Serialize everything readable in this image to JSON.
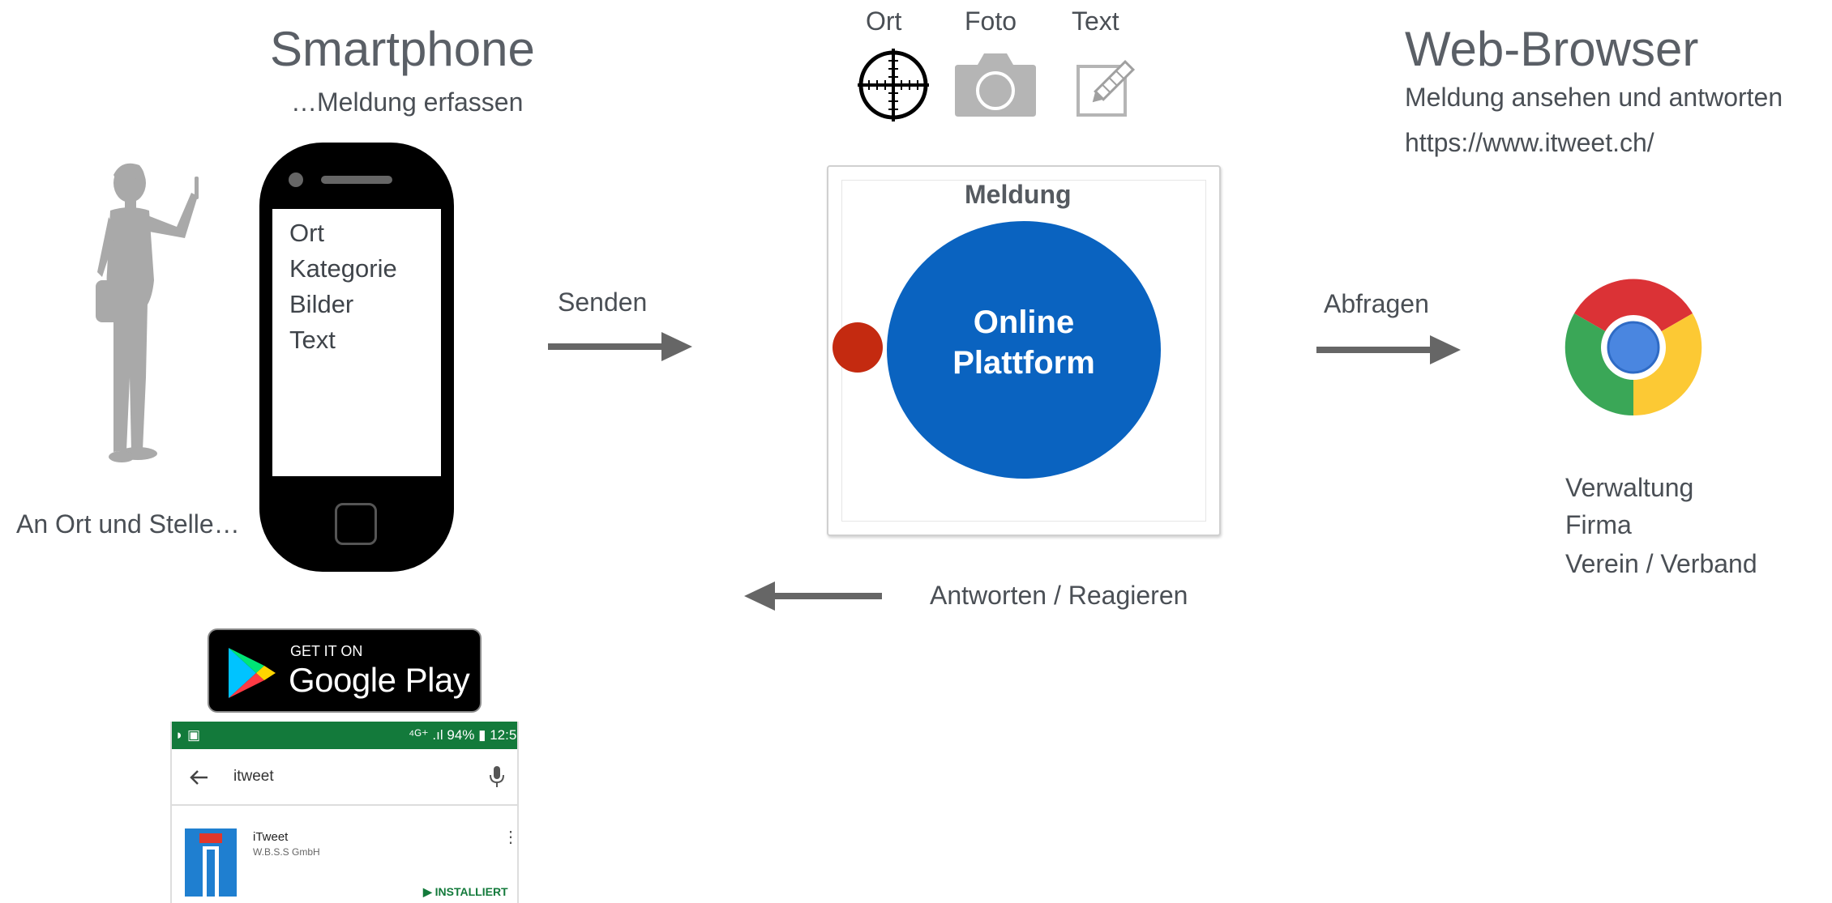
{
  "smartphone": {
    "title": "Smartphone",
    "subtitle": "…Meldung erfassen",
    "screen_lines": [
      "Ort",
      "Kategorie",
      "Bilder",
      "Text"
    ],
    "person_caption": "An Ort und Stelle…"
  },
  "arrows": {
    "send": "Senden",
    "query": "Abfragen",
    "respond": "Antworten / Reagieren"
  },
  "inputs": {
    "items": [
      "Ort",
      "Foto",
      "Text"
    ]
  },
  "platform": {
    "title": "Meldung",
    "circle_line1": "Online",
    "circle_line2": "Plattform"
  },
  "browser": {
    "title": "Web-Browser",
    "subtitle": "Meldung ansehen und antworten",
    "url": "https://www.itweet.ch/",
    "users": [
      "Verwaltung",
      "Firma",
      "Verein / Verband"
    ]
  },
  "google_play": {
    "small": "GET IT ON",
    "big": "Google Play"
  },
  "play_store": {
    "status": "⁴ᴳ⁺ .ıl 94% ▮ 12:5",
    "search_query": "itweet",
    "app_name": "iTweet",
    "developer": "W.B.S.S GmbH",
    "install_label": "▶ INSTALLIERT"
  },
  "colors": {
    "platform_blue": "#0a63c0",
    "dot_red": "#c42a10",
    "arrow_gray": "#666666",
    "play_green": "#137a3b"
  }
}
